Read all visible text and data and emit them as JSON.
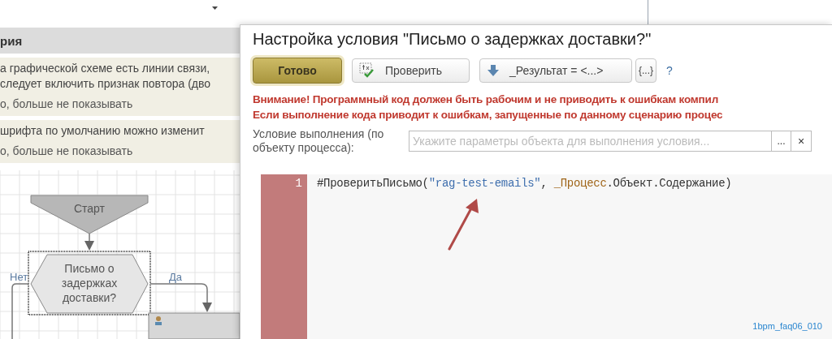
{
  "background": {
    "section_header": "рия",
    "notices": [
      {
        "lines": [
          "а графической схеме есть линии связи,",
          "следует включить признак повтора (дво"
        ],
        "dismiss": "о, больше не показывать"
      },
      {
        "lines": [
          "шрифта по умолчанию можно изменит"
        ],
        "dismiss": "о, больше не показывать"
      }
    ],
    "flowchart": {
      "start": "Старт",
      "condition": [
        "Письмо о",
        "задержках",
        "доставки?"
      ],
      "condition_selected": true,
      "no_label": "Нет",
      "yes_label": "Да"
    }
  },
  "dialog": {
    "title": "Настройка условия \"Письмо о задержках доставки?\"",
    "buttons": [
      {
        "kind": "primary",
        "label": "Готово"
      },
      {
        "kind": "check",
        "label": "Проверить"
      },
      {
        "kind": "dropdown",
        "label": "_Результат = <...>"
      },
      {
        "kind": "braces",
        "label": "{...}"
      },
      {
        "kind": "help",
        "label": "?"
      }
    ],
    "warnings": [
      "Внимание! Программный код должен быть рабочим и не приводить к ошибкам компил",
      "Если выполнение кода приводит к ошибкам, запущенные по данному сценарию процес"
    ],
    "condition_field": {
      "label": "Условие выполнения (по объекту процесса):",
      "placeholder": "Укажите параметры объекта для выполнения условия...",
      "select_button": "...",
      "clear_button": "×"
    },
    "editor": {
      "lines": [
        {
          "number": "1",
          "tokens": [
            {
              "kind": "text",
              "text": "#ПроверитьПисьмо("
            },
            {
              "kind": "string",
              "text": "\"rag-test-emails\""
            },
            {
              "kind": "text",
              "text": ", "
            },
            {
              "kind": "variable",
              "text": "_Процесс"
            },
            {
              "kind": "text",
              "text": ".Объект.Содержание)"
            }
          ]
        }
      ]
    },
    "figure_id": "1bpm_faq06_010"
  }
}
